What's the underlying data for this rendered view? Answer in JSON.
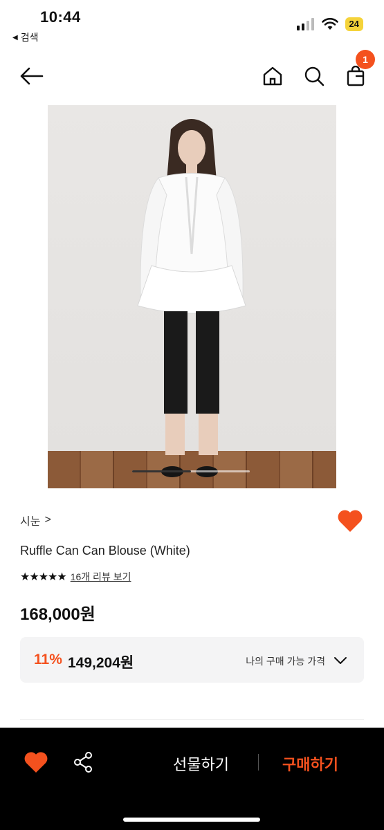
{
  "status_bar": {
    "time": "10:44",
    "back_label": "검색",
    "battery": "24"
  },
  "product": {
    "brand": "시눈",
    "brand_chevron": ">",
    "name": "Ruffle Can Can Blouse (White)",
    "stars": "★★★★★",
    "rating": 5,
    "review_link": "16개 리뷰 보기",
    "price": "168,000원"
  },
  "my_price": {
    "discount": "11%",
    "price": "149,204원",
    "label": "나의 구매 가능 가격"
  },
  "nav": {
    "cart_count": "1"
  },
  "bottom_bar": {
    "gift_label": "선물하기",
    "buy_label": "구매하기"
  },
  "colors": {
    "accent": "#f4511e",
    "battery": "#f5d33a",
    "bottom_bar": "#000000"
  },
  "icons": [
    "back-arrow-icon",
    "home-icon",
    "search-icon",
    "cart-icon",
    "heart-icon",
    "share-icon",
    "chevron-down-icon",
    "signal-icon",
    "wifi-icon"
  ]
}
